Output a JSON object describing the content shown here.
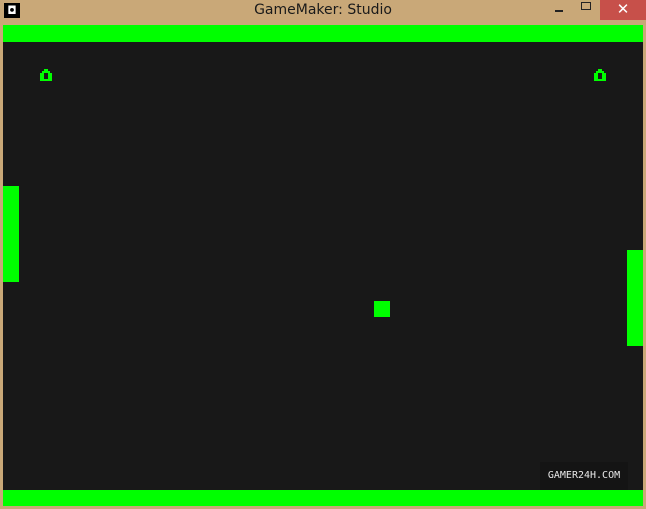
{
  "window": {
    "title": "GameMaker: Studio",
    "app_icon": "gamemaker-icon",
    "controls": [
      "minimize-icon",
      "maximize-icon",
      "close-icon"
    ]
  },
  "game": {
    "background_color": "#181818",
    "accent_color": "#00ff00",
    "scores": {
      "left": "0",
      "right": "0"
    },
    "watermark": "GAMER24H.COM"
  }
}
